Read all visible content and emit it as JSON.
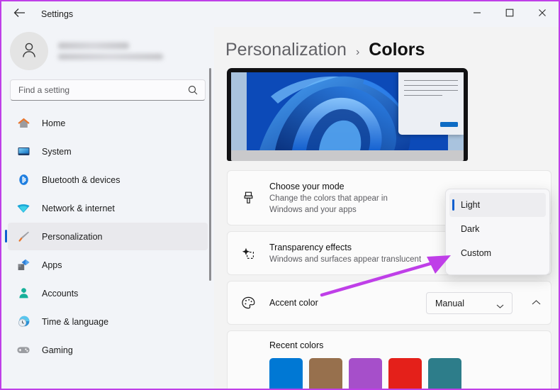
{
  "window": {
    "title": "Settings",
    "back_icon": "back-arrow-icon",
    "controls": {
      "minimize": "minimize-icon",
      "maximize": "maximize-icon",
      "close": "close-icon"
    }
  },
  "sidebar": {
    "profile": {
      "avatar_icon": "person-icon",
      "name": "",
      "email": ""
    },
    "search": {
      "placeholder": "Find a setting",
      "icon": "search-icon"
    },
    "items": [
      {
        "label": "Home",
        "icon": "home-icon",
        "active": false
      },
      {
        "label": "System",
        "icon": "system-icon",
        "active": false
      },
      {
        "label": "Bluetooth & devices",
        "icon": "bluetooth-icon",
        "active": false
      },
      {
        "label": "Network & internet",
        "icon": "wifi-icon",
        "active": false
      },
      {
        "label": "Personalization",
        "icon": "brush-icon",
        "active": true
      },
      {
        "label": "Apps",
        "icon": "apps-icon",
        "active": false
      },
      {
        "label": "Accounts",
        "icon": "account-icon",
        "active": false
      },
      {
        "label": "Time & language",
        "icon": "clock-icon",
        "active": false
      },
      {
        "label": "Gaming",
        "icon": "gamepad-icon",
        "active": false
      }
    ]
  },
  "breadcrumb": {
    "parent": "Personalization",
    "separator": "›",
    "current": "Colors"
  },
  "preview": {
    "alt": "windows-11-bloom-wallpaper-preview"
  },
  "settings": {
    "mode": {
      "icon": "paintbrush-icon",
      "title": "Choose your mode",
      "subtitle_line1": "Change the colors that appear in",
      "subtitle_line2": "Windows and your apps"
    },
    "transparency": {
      "icon": "sparkle-icon",
      "title": "Transparency effects",
      "subtitle": "Windows and surfaces appear translucent"
    },
    "accent": {
      "icon": "palette-icon",
      "title": "Accent color",
      "dropdown_value": "Manual",
      "dropdown_chevron": "chevron-down-icon",
      "expander_chevron": "chevron-up-icon"
    },
    "recent": {
      "label": "Recent colors",
      "colors": [
        "#0078D4",
        "#97704D",
        "#A64FCA",
        "#E4201A",
        "#2D7D8A"
      ]
    }
  },
  "mode_dropdown": {
    "open": true,
    "options": [
      {
        "label": "Light",
        "selected": true
      },
      {
        "label": "Dark",
        "selected": false
      },
      {
        "label": "Custom",
        "selected": false
      }
    ]
  },
  "annotation": {
    "arrow_color": "#bf3fe8",
    "border_color": "#bf3fe8"
  }
}
